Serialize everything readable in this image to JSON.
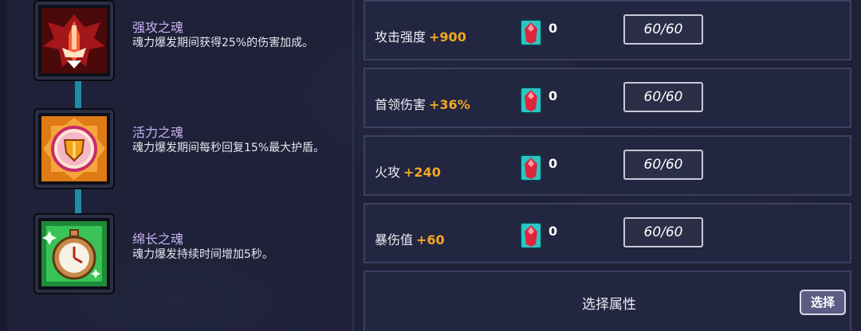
{
  "skills": [
    {
      "title": "强攻之魂",
      "description": "魂力爆发期间获得25%的伤害加成。",
      "icon": "crimson-fighter-icon"
    },
    {
      "title": "活力之魂",
      "description": "魂力爆发期间每秒回复15%最大护盾。",
      "icon": "shield-emblem-icon"
    },
    {
      "title": "绵长之魂",
      "description": "魂力爆发持续时间增加5秒。",
      "icon": "stopwatch-icon"
    }
  ],
  "stats": [
    {
      "label": "攻击强度",
      "bonus": "+900",
      "gem_count": "0",
      "level": "60/60"
    },
    {
      "label": "首领伤害",
      "bonus": "+36%",
      "gem_count": "0",
      "level": "60/60"
    },
    {
      "label": "火攻",
      "bonus": "+240",
      "gem_count": "0",
      "level": "60/60"
    },
    {
      "label": "暴伤值",
      "bonus": "+60",
      "gem_count": "0",
      "level": "60/60"
    }
  ],
  "selector": {
    "prompt": "选择属性",
    "button_label": "选择"
  },
  "colors": {
    "skill_title": "#c7b1f2",
    "bonus": "#f4a623",
    "connector": "#1f8ba8",
    "background": "#1e2137"
  }
}
